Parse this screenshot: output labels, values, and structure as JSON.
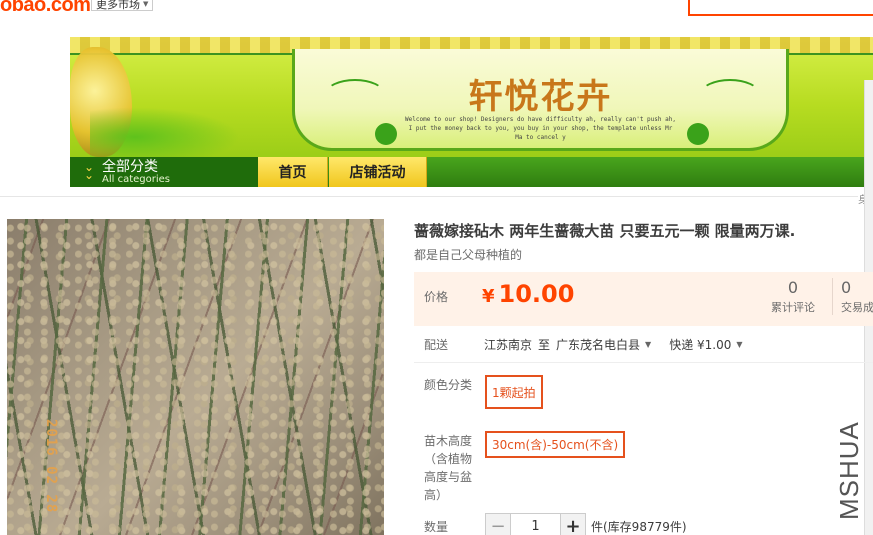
{
  "header": {
    "logo_text": "obao.com",
    "market_select": "更多市场",
    "search_value": ""
  },
  "banner": {
    "shop_name": "轩悦花卉",
    "tagline": "Welcome to our shop! Designers do have difficulty ah, really can't push ah, I put the money back to you, you buy in your shop, the template unless Mr Ma to cancel y"
  },
  "nav": {
    "all_categories_cn": "全部分类",
    "all_categories_en": "All categories",
    "tabs": [
      {
        "label": "首页"
      },
      {
        "label": "店铺活动"
      }
    ],
    "right_edge_text": "身"
  },
  "product": {
    "photo_date_stamp": "2016 02 28",
    "title": "蔷薇嫁接砧木 两年生蔷薇大苗 只要五元一颗 限量两万课.",
    "subtitle": "都是自己父母种植的",
    "price_label": "价格",
    "currency": "¥",
    "price": "10.00",
    "reviews_count": "0",
    "reviews_label": "累计评论",
    "trades_count": "0",
    "trades_label": "交易成"
  },
  "shipping": {
    "label": "配送",
    "from": "江苏南京",
    "to_word": "至",
    "destination": "广东茂名电白县",
    "method": "快递 ¥1.00"
  },
  "options": {
    "color_label": "颜色分类",
    "color_value": "1颗起拍",
    "height_label": "苗木高度（含植物高度与盆高）",
    "height_value": "30cm(含)-50cm(不含)"
  },
  "quantity": {
    "label": "数量",
    "minus": "−",
    "plus": "+",
    "value": "1",
    "unit_stock": "件(库存98779件)"
  },
  "watermark": "MSHUA",
  "colors": {
    "accent": "#ff4400",
    "option_border": "#e5511d",
    "nav_green": "#2f7d10",
    "tab_yellow": "#f0c61d",
    "price_bg": "#fff2e8"
  }
}
